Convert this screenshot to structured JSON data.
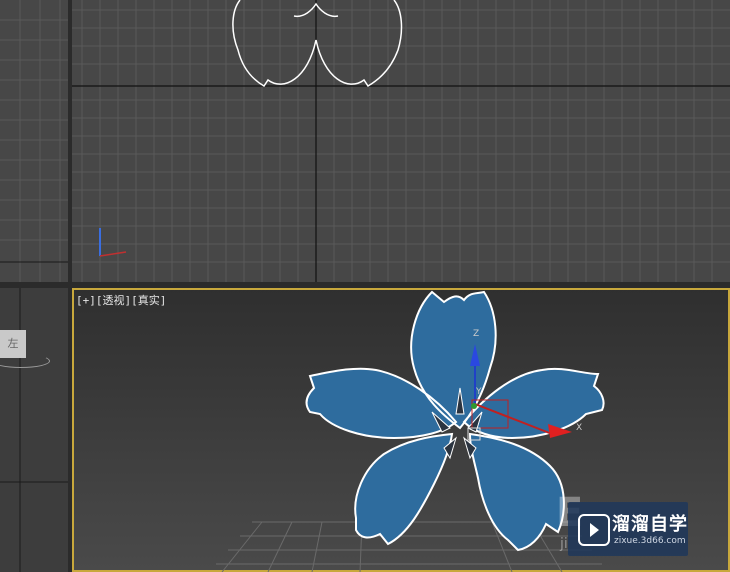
{
  "perspective_viewport": {
    "label_parts": [
      "[+]",
      "[透视]",
      "[真实]"
    ]
  },
  "left_viewport": {
    "viewcube_label": "左"
  },
  "gizmo_axes": {
    "x": "X",
    "y": "Y",
    "z": "Z"
  },
  "watermark": {
    "title": "溜溜自学",
    "url": "zixue.3d66.com",
    "background_letters": "E",
    "background_small": "ji"
  },
  "colors": {
    "viewport_bg": "#474747",
    "grid_line": "#5a5a5a",
    "active_border": "#c8a83c",
    "flower_fill": "#2e6c9e",
    "flower_outline": "#ffffff"
  }
}
